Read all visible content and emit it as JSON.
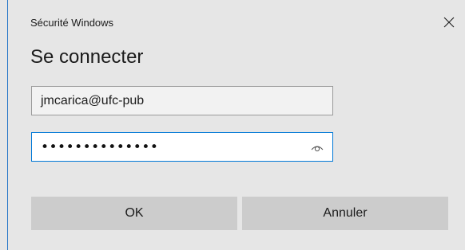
{
  "window": {
    "title": "Sécurité Windows",
    "close_icon": "close-icon"
  },
  "heading": "Se connecter",
  "username": {
    "value": "jmcarica@ufc-pub"
  },
  "password": {
    "masked_value": "••••••••••••••",
    "reveal_icon": "eye-icon"
  },
  "buttons": {
    "ok_label": "OK",
    "cancel_label": "Annuler"
  },
  "colors": {
    "background": "#e6e6e6",
    "focus_border": "#0078d7",
    "button_bg": "#cccccc"
  }
}
